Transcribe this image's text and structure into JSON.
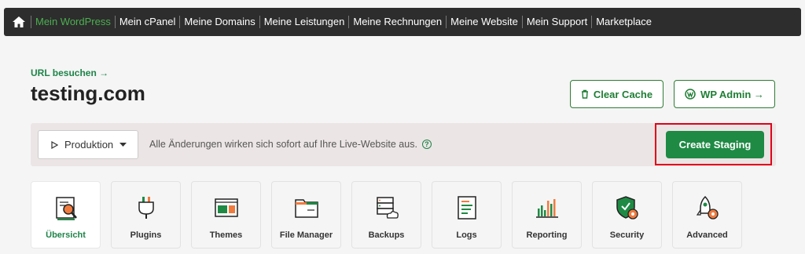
{
  "nav": {
    "items": [
      {
        "label": "Mein WordPress",
        "active": true
      },
      {
        "label": "Mein cPanel"
      },
      {
        "label": "Meine Domains"
      },
      {
        "label": "Meine Leistungen"
      },
      {
        "label": "Meine Rechnungen"
      },
      {
        "label": "Meine Website"
      },
      {
        "label": "Mein Support"
      },
      {
        "label": "Marketplace"
      }
    ]
  },
  "header": {
    "visit_url": "URL besuchen →",
    "site": "testing.com",
    "clear_cache": "Clear Cache",
    "wp_admin": "WP Admin →"
  },
  "environment": {
    "selected": "Produktion",
    "note": "Alle Änderungen wirken sich sofort auf Ihre Live-Website aus.",
    "help": "?",
    "create_staging": "Create Staging"
  },
  "tabs": [
    {
      "label": "Übersicht",
      "icon": "overview-icon",
      "active": true
    },
    {
      "label": "Plugins",
      "icon": "plug-icon"
    },
    {
      "label": "Themes",
      "icon": "themes-icon"
    },
    {
      "label": "File Manager",
      "icon": "folder-icon"
    },
    {
      "label": "Backups",
      "icon": "backup-icon"
    },
    {
      "label": "Logs",
      "icon": "logs-icon"
    },
    {
      "label": "Reporting",
      "icon": "chart-icon"
    },
    {
      "label": "Security",
      "icon": "shield-gear-icon"
    },
    {
      "label": "Advanced",
      "icon": "rocket-gear-icon"
    }
  ],
  "colors": {
    "brand_green": "#1e8a44",
    "active_nav": "#4caf50",
    "highlight": "#e0001a"
  }
}
